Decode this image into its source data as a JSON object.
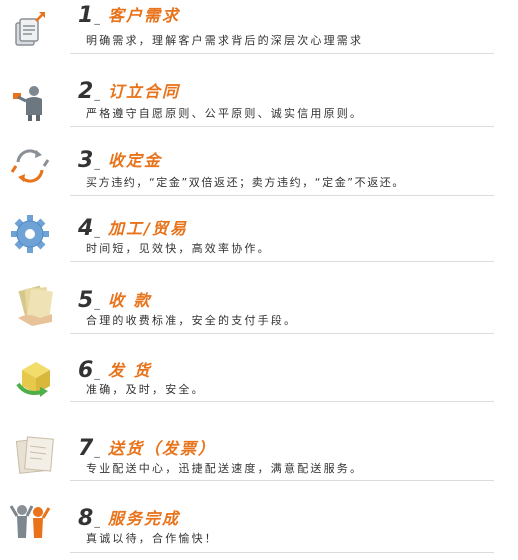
{
  "steps": [
    {
      "number": "1",
      "title": "客户需求",
      "desc": "明确需求，理解客户需求背后的深层次心理需求",
      "icon": "document-arrow-icon"
    },
    {
      "number": "2",
      "title": "订立合同",
      "desc": "严格遵守自愿原则、公平原则、诚实信用原则。",
      "icon": "person-presenting-icon"
    },
    {
      "number": "3",
      "title": "收定金",
      "desc": "买方违约，“定金”双倍返还；卖方违约，“定金”不返还。",
      "icon": "refresh-arrows-icon"
    },
    {
      "number": "4",
      "title": "加工/贸易",
      "desc": "时间短，见效快，高效率协作。",
      "icon": "gear-icon"
    },
    {
      "number": "5",
      "title": "收 款",
      "desc": "合理的收费标准，安全的支付手段。",
      "icon": "money-hand-icon"
    },
    {
      "number": "6",
      "title": "发 货",
      "desc": "准确，及时，安全。",
      "icon": "package-arrow-icon"
    },
    {
      "number": "7",
      "title": "送货（发票）",
      "desc": "专业配送中心，迅捷配送速度，满意配送服务。",
      "icon": "papers-icon"
    },
    {
      "number": "8",
      "title": "服务完成",
      "desc": "真诚以待，合作愉快！",
      "icon": "people-celebrate-icon"
    }
  ],
  "colors": {
    "accent": "#e8731a",
    "text": "#333333",
    "rule": "#dcdcdc"
  }
}
